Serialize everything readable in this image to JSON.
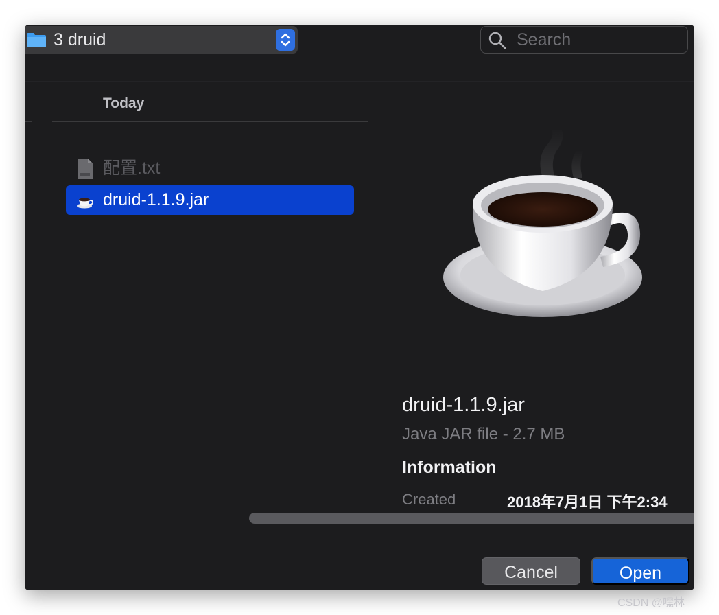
{
  "toolbar": {
    "location_label": "3 druid",
    "location_icon": "folder-icon",
    "stepper_icon": "chevron-up-down-icon",
    "search_placeholder": "Search",
    "search_value": ""
  },
  "file_list": {
    "section_header": "Today",
    "items": [
      {
        "name": "配置.txt",
        "icon": "text-file-icon",
        "state": "dimmed"
      },
      {
        "name": "druid-1.1.9.jar",
        "icon": "java-coffee-icon",
        "state": "selected"
      }
    ]
  },
  "preview": {
    "icon": "java-coffee-cup-icon",
    "file_name": "druid-1.1.9.jar",
    "kind_size": "Java JAR file - 2.7 MB",
    "info_heading": "Information",
    "created_label": "Created",
    "created_value": "2018年7月1日 下午2:34"
  },
  "buttons": {
    "cancel_label": "Cancel",
    "open_label": "Open"
  },
  "watermark": "CSDN @嘿林",
  "colors": {
    "window_bg": "#1c1c1e",
    "selection": "#0a41cf",
    "accent_button": "#1664d8"
  }
}
